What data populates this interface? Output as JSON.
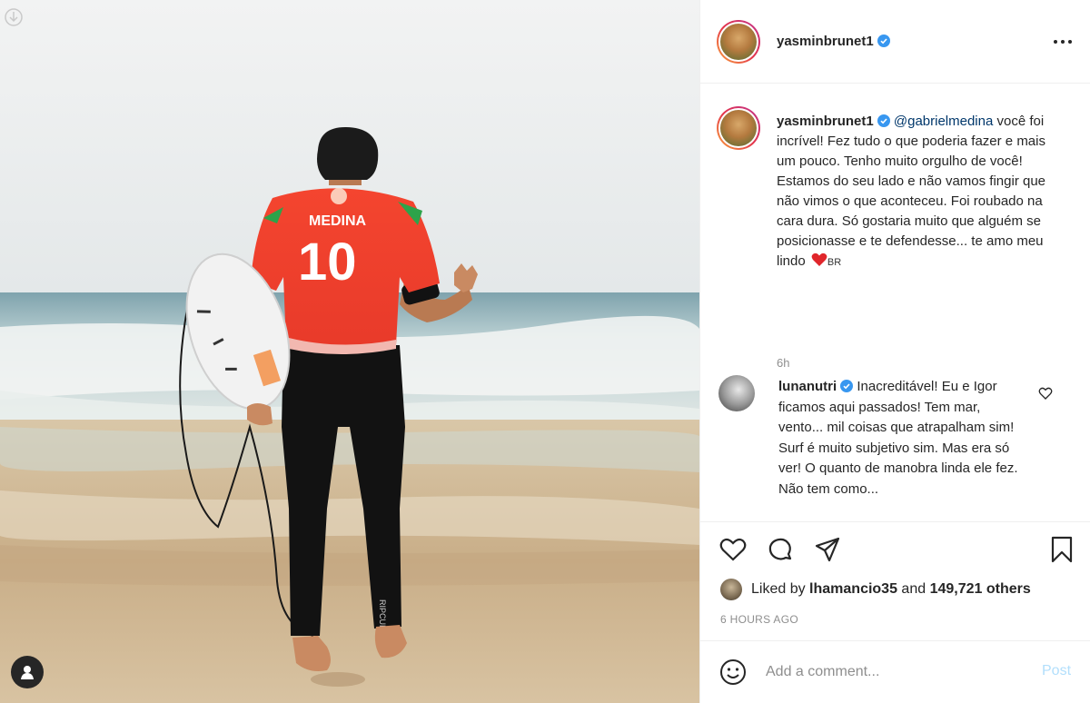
{
  "photo": {
    "jersey_name": "MEDINA",
    "jersey_number": "10",
    "wetsuit_brand": "RIPCURL",
    "alt_subject": "surfer-walking-to-sea",
    "top_icon": "download-arrow-icon",
    "tag_icon": "person-icon"
  },
  "header": {
    "username": "yasminbrunet1",
    "verified": true,
    "more_icon": "more-options-icon"
  },
  "caption": {
    "username": "yasminbrunet1",
    "mention": "@gabrielmedina",
    "text": "você foi incrível! Fez tudo o que poderia fazer e mais um pouco. Tenho muito orgulho de você! Estamos do seu lado e não vamos fingir que não vimos o que aconteceu. Foi roubado na cara dura. Só gostaria muito que alguém se posicionasse e te defendesse... te amo meu lindo",
    "flag": "BR",
    "time": "6h"
  },
  "comment": {
    "username": "lunanutri",
    "text": "Inacreditável! Eu e Igor ficamos aqui passados! Tem mar, vento... mil coisas que atrapalham sim! Surf é muito subjetivo sim. Mas era só ver! O quanto de manobra linda ele fez. Não tem como..."
  },
  "actions": {
    "icons": [
      "heart-icon",
      "comment-icon",
      "share-icon",
      "save-icon"
    ],
    "liked_prefix": "Liked by ",
    "liked_user": "lhamancio35",
    "liked_and": " and ",
    "liked_others": "149,721 others",
    "timestamp": "6 HOURS AGO"
  },
  "add_comment": {
    "placeholder": "Add a comment...",
    "post_label": "Post"
  },
  "colors": {
    "text": "#262626",
    "muted": "#8e8e8e",
    "verified": "#3897f0",
    "mention": "#00376b",
    "post_disabled": "#b2dffc",
    "heart": "#ed4956"
  }
}
